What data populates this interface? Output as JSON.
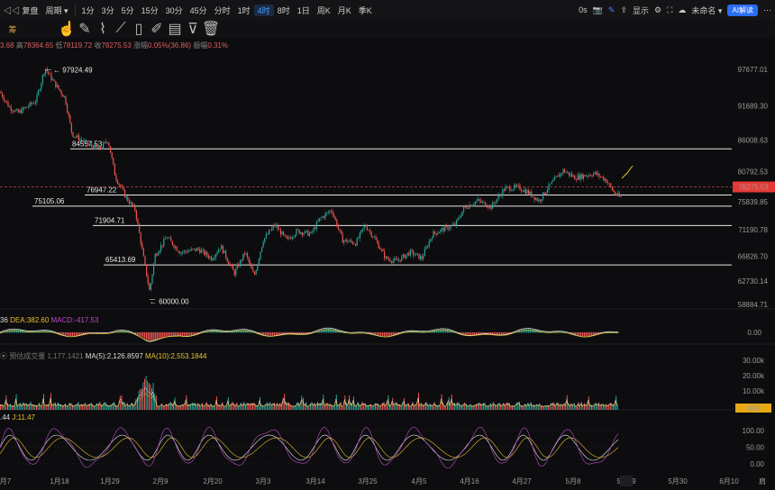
{
  "toolbar": {
    "items": [
      {
        "label": "◁◁ 复盘",
        "name": "replay-button"
      },
      {
        "label": "周期 ▾",
        "name": "period-dropdown"
      },
      {
        "label": "1分",
        "name": "interval-1m"
      },
      {
        "label": "3分",
        "name": "interval-3m"
      },
      {
        "label": "5分",
        "name": "interval-5m"
      },
      {
        "label": "15分",
        "name": "interval-15m"
      },
      {
        "label": "30分",
        "name": "interval-30m"
      },
      {
        "label": "45分",
        "name": "interval-45m"
      },
      {
        "label": "分时",
        "name": "interval-timeshare"
      },
      {
        "label": "1时",
        "name": "interval-1h"
      },
      {
        "label": "4时",
        "name": "interval-4h",
        "selected": true
      },
      {
        "label": "8时",
        "name": "interval-8h"
      },
      {
        "label": "1日",
        "name": "interval-1d"
      },
      {
        "label": "周K",
        "name": "interval-1w"
      },
      {
        "label": "月K",
        "name": "interval-1mo"
      },
      {
        "label": "季K",
        "name": "interval-1q"
      }
    ],
    "right": {
      "delay": "0s",
      "display_label": "显示",
      "unnamed_label": "未命名 ▾",
      "ai_label": "AI解读"
    }
  },
  "draw_tools": [
    "hand-icon",
    "pen-icon",
    "brush-icon",
    "ruler-icon",
    "clipboard-icon",
    "edit-icon",
    "table-icon",
    "filter-icon",
    "trash-icon"
  ],
  "ohlc": {
    "o_val": "3.68",
    "h_key": "高",
    "h_val": "78364.65",
    "l_key": "低",
    "l_val": "78119.72",
    "c_key": "收",
    "c_val": "78275.53",
    "chg_key": "涨幅",
    "chg_val": "0.05%(36.86)",
    "amp_key": "振幅",
    "amp_val": "0.31%"
  },
  "price_axis": [
    "97677.01",
    "91689.30",
    "86008.63",
    "80792.53",
    "75839.85",
    "71190.78",
    "66826.70",
    "62730.14",
    "58884.71"
  ],
  "current_price": "78275.53",
  "levels": [
    {
      "label": "84557.53",
      "price": 84557.53
    },
    {
      "label": "76947.22",
      "price": 76947.22
    },
    {
      "label": "75105.06",
      "price": 75105.06
    },
    {
      "label": "71904.71",
      "price": 71904.71
    },
    {
      "label": "65413.69",
      "price": 65413.69
    }
  ],
  "extremes": {
    "high": "97924.49",
    "low": "60000.00"
  },
  "macd": {
    "dif_val": "36",
    "dea_label": "DEA:382.60",
    "macd_label": "MACD:-417.53",
    "axis": "0.00"
  },
  "volume": {
    "label": "预估成交量 1,177.1421",
    "ma5": "MA(5):2,126.8597",
    "ma10": "MA(10):2,553.1844",
    "axis": [
      "30.00k",
      "20.00k",
      "10.00k"
    ],
    "badge": "450"
  },
  "kdj": {
    "v1": ".44",
    "v2": "J:11.47",
    "axis": [
      "100.00",
      "50.00",
      "0.00"
    ]
  },
  "x_axis": [
    "月7",
    "1月18",
    "1月29",
    "2月9",
    "2月20",
    "3月3",
    "3月14",
    "3月25",
    "4月5",
    "4月16",
    "4月27",
    "5月8",
    "5月19",
    "5月30",
    "6月10",
    "肩"
  ],
  "colors": {
    "up": "#26a69a",
    "down": "#ef5350",
    "accent": "#3b8cff"
  }
}
